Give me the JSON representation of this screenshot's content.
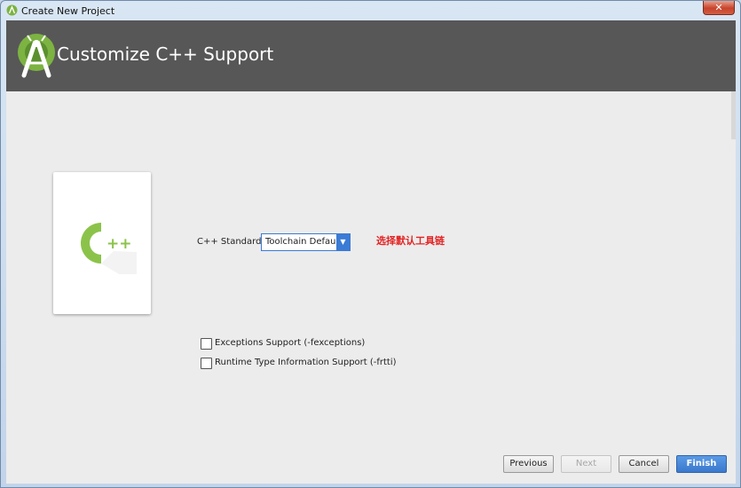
{
  "window": {
    "title": "Create New Project",
    "close_glyph": "✕"
  },
  "header": {
    "title": "Customize C++ Support",
    "logo_icon": "android-studio-icon"
  },
  "card": {
    "logo_letter": "C",
    "logo_suffix": "++",
    "accent_color": "#8bc34a"
  },
  "form": {
    "cpp_standard_label": "C++ Standard",
    "cpp_standard_value": "Toolchain Default",
    "annotation": "选择默认工具链",
    "annotation_color": "#e32424",
    "checkboxes": [
      {
        "label": "Exceptions Support (-fexceptions)",
        "checked": false
      },
      {
        "label": "Runtime Type Information Support (-frtti)",
        "checked": false
      }
    ]
  },
  "buttons": {
    "previous": "Previous",
    "next": "Next",
    "cancel": "Cancel",
    "finish": "Finish"
  }
}
